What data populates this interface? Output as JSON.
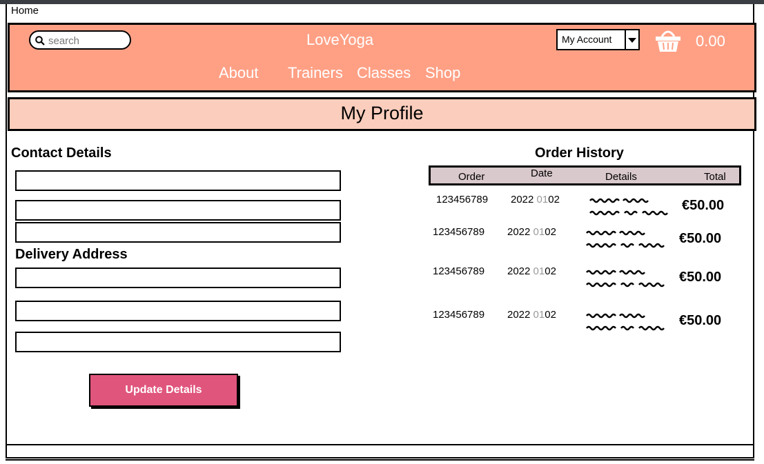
{
  "breadcrumb": "Home",
  "header": {
    "search_placeholder": "search",
    "brand": "LoveYoga",
    "nav": [
      "About",
      "Trainers",
      "Classes",
      "Shop"
    ],
    "account_label": "My Account",
    "cart_total": "0.00"
  },
  "page_title": "My Profile",
  "contact_title": "Contact Details",
  "delivery_title": "Delivery Address",
  "update_label": "Update Details",
  "orders": {
    "title": "Order History",
    "columns": [
      "Order",
      "Date",
      "Details",
      "Total"
    ],
    "rows": [
      {
        "order": "123456789",
        "date_a": "2022 ",
        "date_b": "01",
        "date_c": "02",
        "total": "€50.00"
      },
      {
        "order": "123456789",
        "date_a": "2022 ",
        "date_b": "01",
        "date_c": "02",
        "total": "€50.00"
      },
      {
        "order": "123456789",
        "date_a": "2022 ",
        "date_b": "01",
        "date_c": "02",
        "total": "€50.00"
      },
      {
        "order": "123456789",
        "date_a": "2022 ",
        "date_b": "01",
        "date_c": "02",
        "total": "€50.00"
      }
    ]
  },
  "colors": {
    "header": "#ffa085",
    "pagebar": "#fbcdbc",
    "button": "#e0557c",
    "table_head": "#d9c8cc"
  }
}
